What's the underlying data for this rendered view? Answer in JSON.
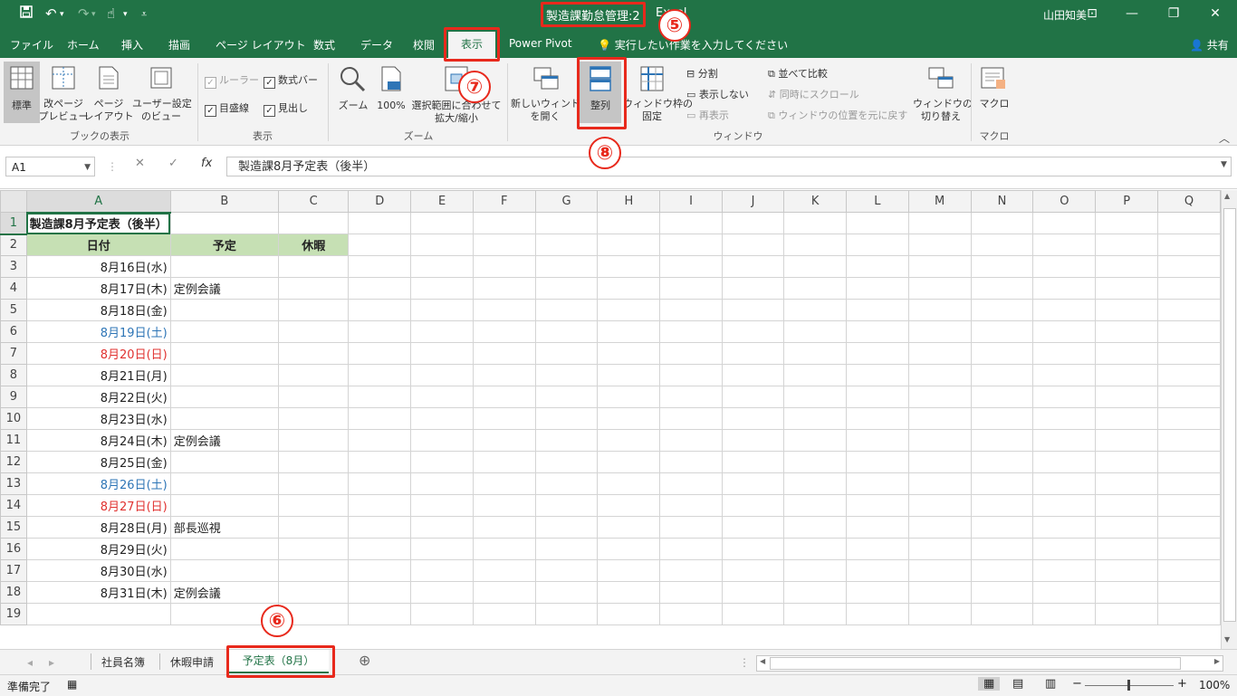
{
  "window": {
    "title": "製造課勤怠管理:2",
    "app": "Excel",
    "user": "山田知美"
  },
  "ribbon_tabs": [
    "ファイル",
    "ホーム",
    "挿入",
    "描画",
    "ページ レイアウト",
    "数式",
    "データ",
    "校閲",
    "表示",
    "Power Pivot"
  ],
  "tell_me": "実行したい作業を入力してください",
  "share": "共有",
  "ribbon": {
    "workbook_views": {
      "normal": "標準",
      "page_break": "改ページ\nプレビュー",
      "page_layout": "ページ\nレイアウト",
      "custom": "ユーザー設定\nのビュー",
      "group": "ブックの表示"
    },
    "show": {
      "ruler": "ルーラー",
      "formula_bar": "数式バー",
      "gridlines": "目盛線",
      "headings": "見出し",
      "group": "表示"
    },
    "zoom": {
      "zoom": "ズーム",
      "zoom100": "100%",
      "zoom_sel": "選択範囲に合わせて\n拡大/縮小",
      "group": "ズーム"
    },
    "window": {
      "new_window": "新しいウィンドウ\nを開く",
      "arrange": "整列",
      "freeze": "ウィンドウ枠の\n固定",
      "split": "分割",
      "hide": "表示しない",
      "unhide": "再表示",
      "side_by_side": "並べて比較",
      "sync_scroll": "同時にスクロール",
      "reset_pos": "ウィンドウの位置を元に戻す",
      "switch": "ウィンドウの\n切り替え",
      "group": "ウィンドウ"
    },
    "macro": {
      "macro": "マクロ",
      "group": "マクロ"
    }
  },
  "formula_bar": {
    "cell_ref": "A1",
    "content": "製造課8月予定表（後半）"
  },
  "columns": [
    "A",
    "B",
    "C",
    "D",
    "E",
    "F",
    "G",
    "H",
    "I",
    "J",
    "K",
    "L",
    "M",
    "N",
    "O",
    "P",
    "Q"
  ],
  "rows": [
    {
      "n": "1",
      "a": "製造課8月予定表（後半）",
      "b": "",
      "c": ""
    },
    {
      "n": "2",
      "a": "日付",
      "b": "予定",
      "c": "休暇"
    },
    {
      "n": "3",
      "a": "8月16日(水)",
      "b": "",
      "c": ""
    },
    {
      "n": "4",
      "a": "8月17日(木)",
      "b": "定例会議",
      "c": ""
    },
    {
      "n": "5",
      "a": "8月18日(金)",
      "b": "",
      "c": ""
    },
    {
      "n": "6",
      "a": "8月19日(土)",
      "b": "",
      "c": ""
    },
    {
      "n": "7",
      "a": "8月20日(日)",
      "b": "",
      "c": ""
    },
    {
      "n": "8",
      "a": "8月21日(月)",
      "b": "",
      "c": ""
    },
    {
      "n": "9",
      "a": "8月22日(火)",
      "b": "",
      "c": ""
    },
    {
      "n": "10",
      "a": "8月23日(水)",
      "b": "",
      "c": ""
    },
    {
      "n": "11",
      "a": "8月24日(木)",
      "b": "定例会議",
      "c": ""
    },
    {
      "n": "12",
      "a": "8月25日(金)",
      "b": "",
      "c": ""
    },
    {
      "n": "13",
      "a": "8月26日(土)",
      "b": "",
      "c": ""
    },
    {
      "n": "14",
      "a": "8月27日(日)",
      "b": "",
      "c": ""
    },
    {
      "n": "15",
      "a": "8月28日(月)",
      "b": "部長巡視",
      "c": ""
    },
    {
      "n": "16",
      "a": "8月29日(火)",
      "b": "",
      "c": ""
    },
    {
      "n": "17",
      "a": "8月30日(水)",
      "b": "",
      "c": ""
    },
    {
      "n": "18",
      "a": "8月31日(木)",
      "b": "定例会議",
      "c": ""
    },
    {
      "n": "19",
      "a": "",
      "b": "",
      "c": ""
    }
  ],
  "sheet_tabs": [
    "社員名簿",
    "休暇申請",
    "予定表（8月）"
  ],
  "status": {
    "ready": "準備完了",
    "zoom": "100%"
  },
  "callouts": {
    "c5": "⑤",
    "c6": "⑥",
    "c7": "⑦",
    "c8": "⑧"
  },
  "colors": {
    "excel_green": "#217346",
    "header_fill": "#c6e0b4",
    "saturday": "#2e75b6",
    "sunday": "#e0312f",
    "annotation": "#e8291c"
  }
}
